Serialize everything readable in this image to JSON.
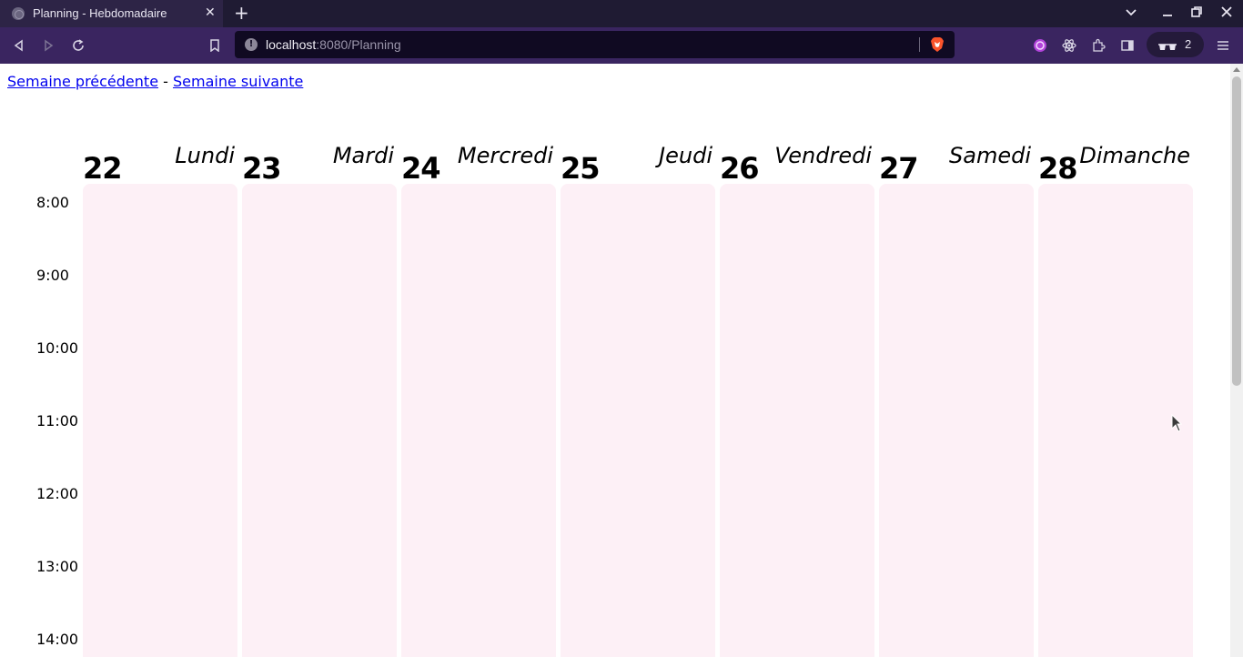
{
  "browser": {
    "tab_title": "Planning - Hebdomadaire",
    "url_host": "localhost",
    "url_rest": ":8080/Planning",
    "vpn_count": "2"
  },
  "nav": {
    "prev_week": "Semaine précédente",
    "separator": " - ",
    "next_week": "Semaine suivante"
  },
  "hours": [
    "8:00",
    "9:00",
    "10:00",
    "11:00",
    "12:00",
    "13:00",
    "14:00"
  ],
  "days": [
    {
      "num": "22",
      "name": "Lundi"
    },
    {
      "num": "23",
      "name": "Mardi"
    },
    {
      "num": "24",
      "name": "Mercredi"
    },
    {
      "num": "25",
      "name": "Jeudi"
    },
    {
      "num": "26",
      "name": "Vendredi"
    },
    {
      "num": "27",
      "name": "Samedi"
    },
    {
      "num": "28",
      "name": "Dimanche"
    }
  ],
  "colors": {
    "day_background": "#fdf0f6",
    "link": "#0000ee",
    "toolbar": "#3a2560"
  }
}
